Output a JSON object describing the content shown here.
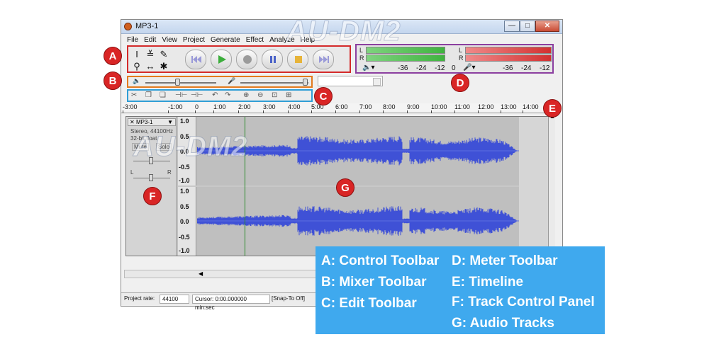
{
  "window": {
    "title": "MP3-1",
    "buttons": {
      "minimize": "—",
      "maximize": "□",
      "close": "✕"
    }
  },
  "menu": [
    "File",
    "Edit",
    "View",
    "Project",
    "Generate",
    "Effect",
    "Analyze",
    "Help"
  ],
  "watermark": "AU-DM2",
  "meter": {
    "playback_scale": [
      "-36",
      "-24",
      "-12",
      "0"
    ],
    "record_scale": [
      "-36",
      "-24",
      "-12"
    ],
    "channel_labels": [
      "L",
      "R"
    ],
    "play_color": "#4cc24c",
    "record_color": "#e24040"
  },
  "timeline": {
    "ticks": [
      "-3:00",
      "-1:00",
      "0",
      "1:00",
      "2:00",
      "3:00",
      "4:00",
      "5:00",
      "6:00",
      "7:00",
      "8:00",
      "9:00",
      "10:00",
      "11:00",
      "12:00",
      "13:00",
      "14:00"
    ]
  },
  "track": {
    "name": "MP3-1",
    "info_format": "Stereo, 44100Hz",
    "info_bits": "32-bit float",
    "mute_label": "Mute",
    "solo_label": "Solo",
    "pan_left": "L",
    "pan_right": "R",
    "scale_labels": [
      "1.0",
      "0.5",
      "0.0",
      "-0.5",
      "-1.0"
    ],
    "wave_color": "#3f51d6"
  },
  "status": {
    "project_rate_label": "Project rate:",
    "project_rate_value": "44100",
    "cursor_text": "Cursor: 0:00.000000 min:sec",
    "snap_text": "[Snap-To Off]"
  },
  "badges": {
    "a": "A",
    "b": "B",
    "c": "C",
    "d": "D",
    "e": "E",
    "f": "F",
    "g": "G"
  },
  "legend": {
    "a": "A: Control Toolbar",
    "b": "B: Mixer Toolbar",
    "c": "C: Edit Toolbar",
    "d": "D: Meter Toolbar",
    "e": "E: Timeline",
    "f": "F: Track Control Panel",
    "g": "G: Audio Tracks"
  }
}
